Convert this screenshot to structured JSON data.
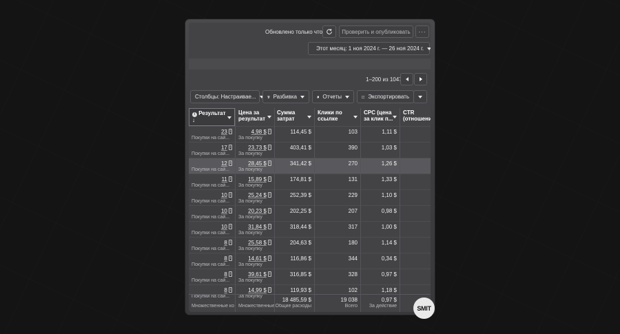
{
  "toolbar": {
    "updated": "Обновлено только что",
    "publish": "Проверить и опубликовать",
    "more": "···"
  },
  "date_range": {
    "label": "Этот месяц: 1 ноя 2024 г. — 26 ноя 2024 г."
  },
  "pagination": {
    "label": "1–200 из 1047"
  },
  "controls": {
    "columns": "Столбцы: Настраивае...",
    "breakdown": "Разбивка",
    "reports": "Отчеты",
    "export": "Экспортировать"
  },
  "columns": [
    {
      "line1": "Результат",
      "line2": "↓"
    },
    {
      "line1": "Цена за",
      "line2": "результат"
    },
    {
      "line1": "Сумма",
      "line2": "затрат"
    },
    {
      "line1": "Клики по",
      "line2": "ссылке"
    },
    {
      "line1": "CPC (цена",
      "line2": "за клик п..."
    },
    {
      "line1": "CTR",
      "line2": "(отношени..."
    }
  ],
  "rows": [
    {
      "result": "23",
      "result_sub": "Покупки на сай...",
      "cpr": "4,98 $",
      "cpr_sub": "За покупку",
      "spend": "114,45 $",
      "clicks": "103",
      "cpc": "1,11 $"
    },
    {
      "result": "17",
      "result_sub": "Покупки на сай...",
      "cpr": "23,73 $",
      "cpr_sub": "За покупку",
      "spend": "403,41 $",
      "clicks": "390",
      "cpc": "1,03 $"
    },
    {
      "result": "12",
      "result_sub": "Покупки на сай...",
      "cpr": "28,45 $",
      "cpr_sub": "За покупку",
      "spend": "341,42 $",
      "clicks": "270",
      "cpc": "1,26 $"
    },
    {
      "result": "11",
      "result_sub": "Покупки на сай...",
      "cpr": "15,89 $",
      "cpr_sub": "За покупку",
      "spend": "174,81 $",
      "clicks": "131",
      "cpc": "1,33 $"
    },
    {
      "result": "10",
      "result_sub": "Покупки на сай...",
      "cpr": "25,24 $",
      "cpr_sub": "За покупку",
      "spend": "252,39 $",
      "clicks": "229",
      "cpc": "1,10 $"
    },
    {
      "result": "10",
      "result_sub": "Покупки на сай...",
      "cpr": "20,23 $",
      "cpr_sub": "За покупку",
      "spend": "202,25 $",
      "clicks": "207",
      "cpc": "0,98 $"
    },
    {
      "result": "10",
      "result_sub": "Покупки на сай...",
      "cpr": "31,84 $",
      "cpr_sub": "За покупку",
      "spend": "318,44 $",
      "clicks": "317",
      "cpc": "1,00 $"
    },
    {
      "result": "8",
      "result_sub": "Покупки на сай...",
      "cpr": "25,58 $",
      "cpr_sub": "За покупку",
      "spend": "204,63 $",
      "clicks": "180",
      "cpc": "1,14 $"
    },
    {
      "result": "8",
      "result_sub": "Покупки на сай...",
      "cpr": "14,61 $",
      "cpr_sub": "За покупку",
      "spend": "116,86 $",
      "clicks": "344",
      "cpc": "0,34 $"
    },
    {
      "result": "8",
      "result_sub": "Покупки на сай...",
      "cpr": "39,61 $",
      "cpr_sub": "За покупку",
      "spend": "316,85 $",
      "clicks": "328",
      "cpc": "0,97 $"
    },
    {
      "result": "8",
      "result_sub": "Покупки на сай...",
      "cpr": "14,99 $",
      "cpr_sub": "За покупку",
      "spend": "119,93 $",
      "clicks": "102",
      "cpc": "1,18 $"
    }
  ],
  "totals": {
    "result_sub": "Множественные ко",
    "cpr_sub": "Множественные",
    "spend": "18 485,59 $",
    "spend_sub": "Общие расходы",
    "clicks": "19 038",
    "clicks_sub": "Всего",
    "cpc": "0,97 $",
    "cpc_sub": "За действие"
  },
  "logo": {
    "text": "SMIT"
  },
  "colors": {
    "background": "#141414",
    "panel": "#434346",
    "highlight_row": "#59595d"
  }
}
